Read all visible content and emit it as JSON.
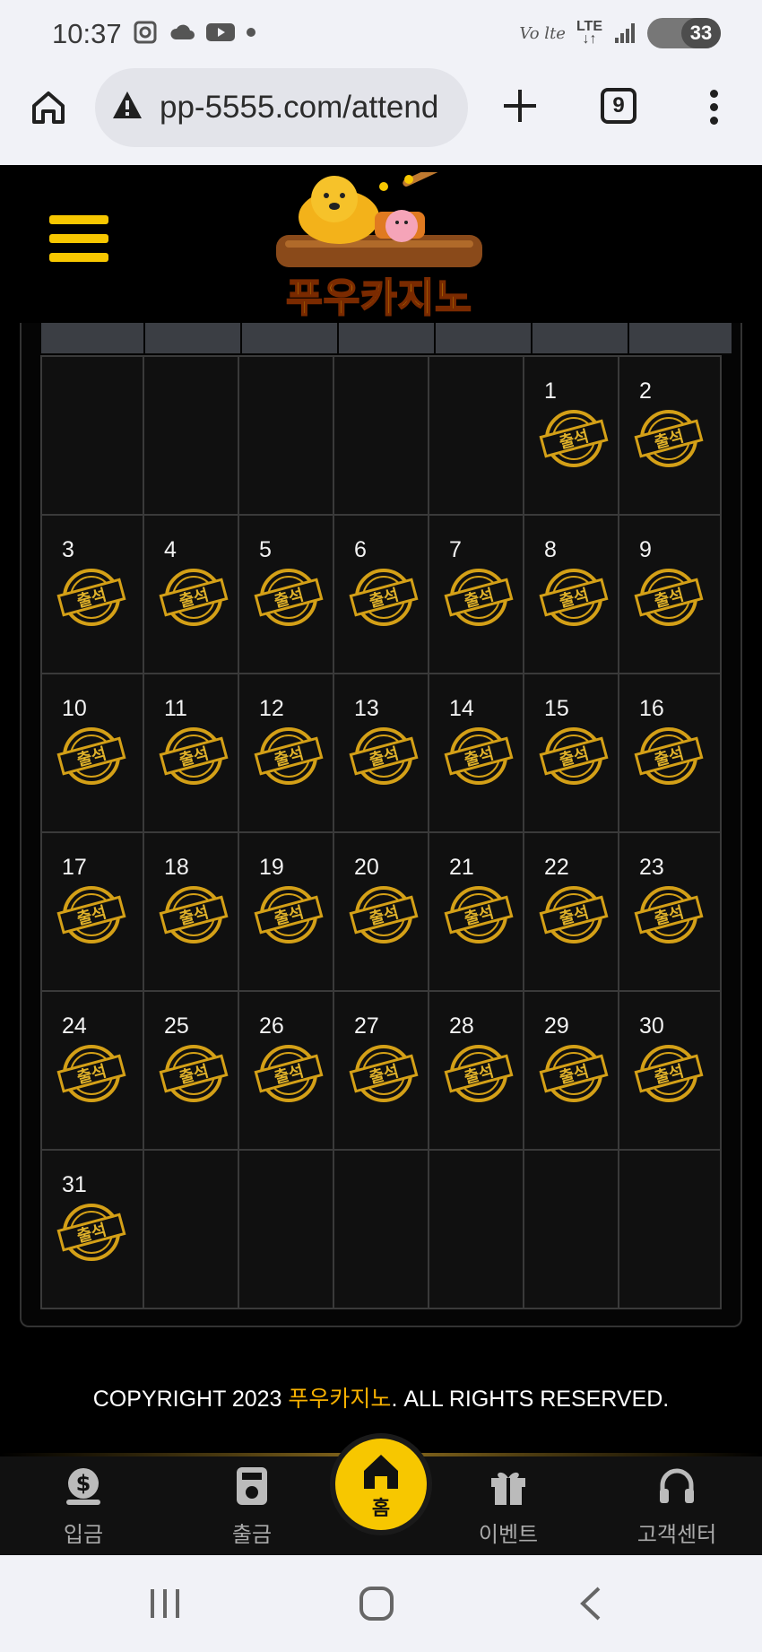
{
  "status_bar": {
    "time": "10:37",
    "network_volte": "Vo lte",
    "network_lte": "LTE",
    "battery": "33"
  },
  "browser": {
    "url": "pp-5555.com/attend",
    "tab_count": "9"
  },
  "site": {
    "logo_text": "푸우카지노"
  },
  "calendar": {
    "stamp_label": "출석",
    "weeks": [
      [
        "",
        "",
        "",
        "",
        "",
        "1",
        "2"
      ],
      [
        "3",
        "4",
        "5",
        "6",
        "7",
        "8",
        "9"
      ],
      [
        "10",
        "11",
        "12",
        "13",
        "14",
        "15",
        "16"
      ],
      [
        "17",
        "18",
        "19",
        "20",
        "21",
        "22",
        "23"
      ],
      [
        "24",
        "25",
        "26",
        "27",
        "28",
        "29",
        "30"
      ],
      [
        "31",
        "",
        "",
        "",
        "",
        "",
        ""
      ]
    ]
  },
  "footer": {
    "copyright_prefix": "COPYRIGHT 2023 ",
    "copyright_brand": "푸우카지노",
    "copyright_suffix": ". ALL RIGHTS RESERVED."
  },
  "bottom_nav": {
    "deposit": "입금",
    "withdraw": "출금",
    "home": "홈",
    "event": "이벤트",
    "support": "고객센터"
  },
  "colors": {
    "accent": "#f7c700",
    "stamp_gold": "#d4a017",
    "cell_bg": "#101010"
  }
}
